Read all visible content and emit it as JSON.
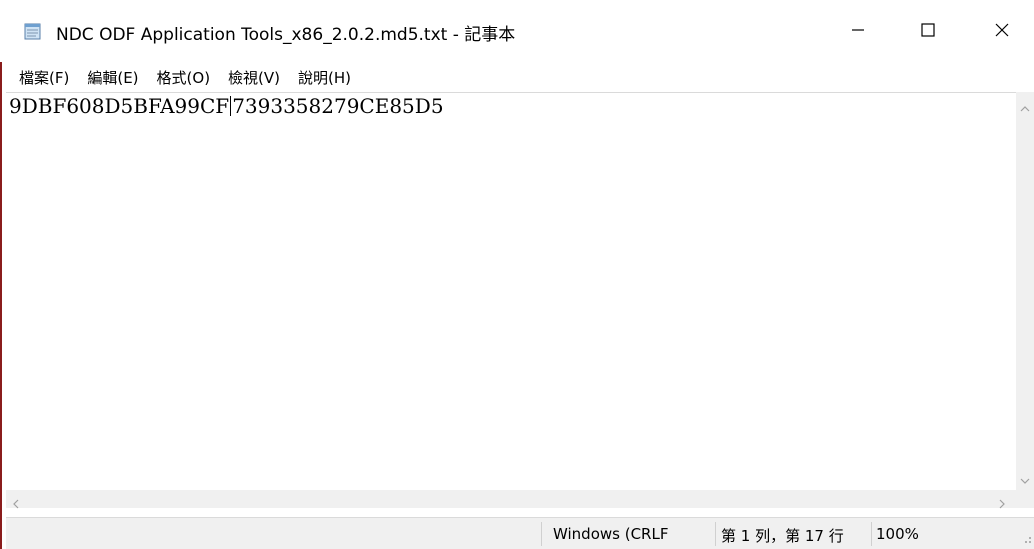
{
  "window": {
    "title": "NDC ODF Application Tools_x86_2.0.2.md5.txt - 記事本"
  },
  "menu": {
    "items": [
      {
        "label": "檔案(F)"
      },
      {
        "label": "編輯(E)"
      },
      {
        "label": "格式(O)"
      },
      {
        "label": "檢視(V)"
      },
      {
        "label": "說明(H)"
      }
    ]
  },
  "editor": {
    "text_before_caret": "9DBF608D5BFA99CF",
    "text_after_caret": "7393358279CE85D5"
  },
  "status": {
    "line_ending": "Windows (CRLF",
    "position": "第 1 列，第 17 行",
    "zoom": "100%"
  },
  "colors": {
    "accent_border": "#8a1c1c",
    "chrome_background": "#f0f0f0"
  },
  "icons": {
    "app": "notepad-icon",
    "minimize": "minimize-icon",
    "maximize": "maximize-icon",
    "close": "close-icon"
  }
}
